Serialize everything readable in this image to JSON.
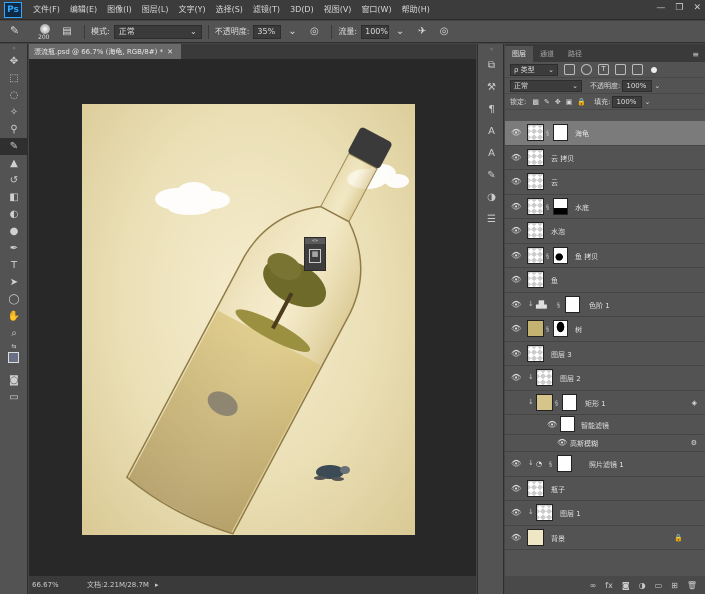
{
  "menu": {
    "logo": "Ps",
    "items": [
      "文件(F)",
      "编辑(E)",
      "图像(I)",
      "图层(L)",
      "文字(Y)",
      "选择(S)",
      "滤镜(T)",
      "3D(D)",
      "视图(V)",
      "窗口(W)",
      "帮助(H)"
    ]
  },
  "options": {
    "brush_size": "200",
    "mode_label": "模式:",
    "mode_value": "正常",
    "opacity_label": "不透明度:",
    "opacity_value": "35%",
    "flow_label": "流量:",
    "flow_value": "100%"
  },
  "document": {
    "tab_title": "漂流瓶.psd @ 66.7% (海龟, RGB/8#) *",
    "zoom": "66.67%",
    "doc_size": "文档:2.21M/28.7M"
  },
  "layers_panel": {
    "tabs": [
      "图层",
      "通道",
      "路径"
    ],
    "filter_kind": "ρ 类型",
    "blend_mode": "正常",
    "opacity_label": "不透明度:",
    "opacity_value": "100%",
    "lock_label": "锁定:",
    "fill_label": "填充:",
    "fill_value": "100%",
    "layers": [
      {
        "name": "海龟"
      },
      {
        "name": "云 拷贝"
      },
      {
        "name": "云"
      },
      {
        "name": "水底"
      },
      {
        "name": "水泡"
      },
      {
        "name": "鱼 拷贝"
      },
      {
        "name": "鱼"
      },
      {
        "name": "色阶 1"
      },
      {
        "name": "树"
      },
      {
        "name": "图层 3"
      },
      {
        "name": "图层 2"
      },
      {
        "name": "矩形 1"
      },
      {
        "name": "智能滤镜"
      },
      {
        "name": "高斯模糊"
      },
      {
        "name": "照片滤镜 1"
      },
      {
        "name": "瓶子"
      },
      {
        "name": "图层 1"
      },
      {
        "name": "背景"
      }
    ]
  },
  "colors": {
    "canvas_bg": "#eadfb5",
    "accent": "#31a8ff"
  }
}
